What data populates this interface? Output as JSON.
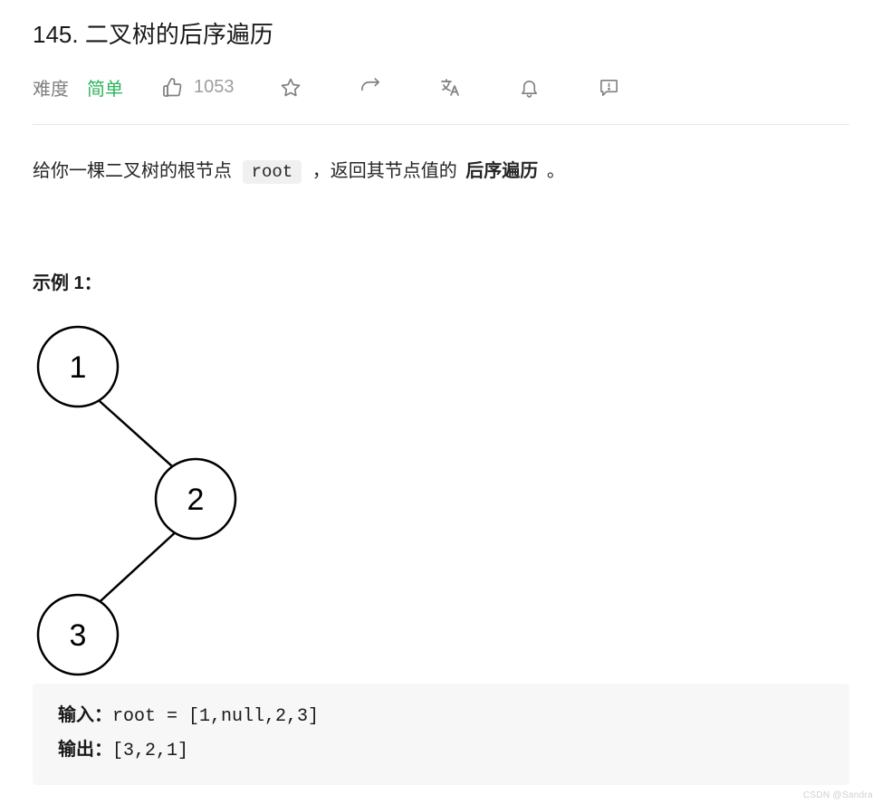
{
  "title": "145. 二叉树的后序遍历",
  "meta": {
    "difficulty_label": "难度",
    "difficulty_value": "简单",
    "likes_count": "1053"
  },
  "description": {
    "pre_text": "给你一棵二叉树的根节点 ",
    "code_token": "root",
    "mid_text": " ，返回其节点值的 ",
    "strong_text": "后序遍历",
    "end_text": " 。"
  },
  "example": {
    "heading": "示例 1：",
    "tree_nodes": [
      "1",
      "2",
      "3"
    ],
    "input_label": "输入：",
    "input_value": "root = [1,null,2,3]",
    "output_label": "输出：",
    "output_value": "[3,2,1]"
  },
  "watermark": "CSDN @Sandra"
}
